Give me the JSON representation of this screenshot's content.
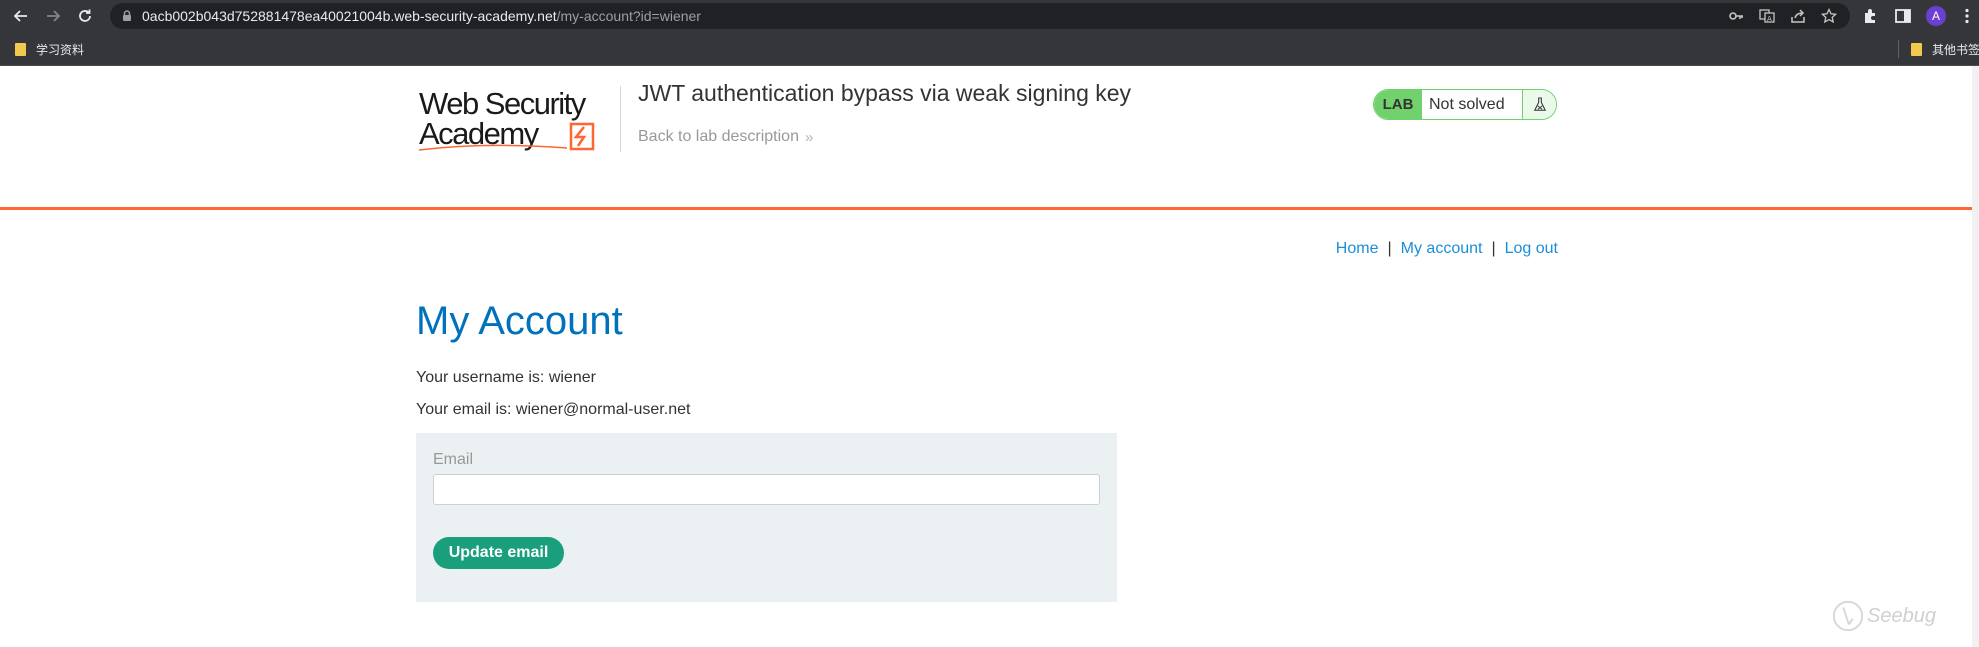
{
  "browser": {
    "url_host": "0acb002b043d752881478ea40021004b.web-security-academy.net",
    "url_path": "/my-account?id=wiener",
    "avatar_letter": "A",
    "bookmarks": [
      "学习资料",
      "其他书签"
    ]
  },
  "header": {
    "lab_title": "JWT authentication bypass via weak signing key",
    "back_link": "Back to lab description",
    "lab_tag": "LAB",
    "lab_status": "Not solved",
    "logo_text": [
      "Web Security",
      "Academy"
    ]
  },
  "nav": {
    "home": "Home",
    "sep1": "|",
    "my_account": "My account",
    "sep2": "|",
    "log_out": "Log out"
  },
  "main": {
    "title": "My Account",
    "username_line": "Your username is: wiener",
    "email_line": "Your email is: wiener@normal-user.net",
    "form": {
      "email_label": "Email",
      "email_value": "",
      "submit_label": "Update email"
    }
  },
  "watermark": "Seebug",
  "colors": {
    "brand_orange": "#ff6633",
    "heading_blue": "#0071bc",
    "link_blue": "#1a8fd8",
    "lab_green": "#70d16d",
    "button_green": "#1a9f7d",
    "form_bg": "#ebf0f2"
  }
}
